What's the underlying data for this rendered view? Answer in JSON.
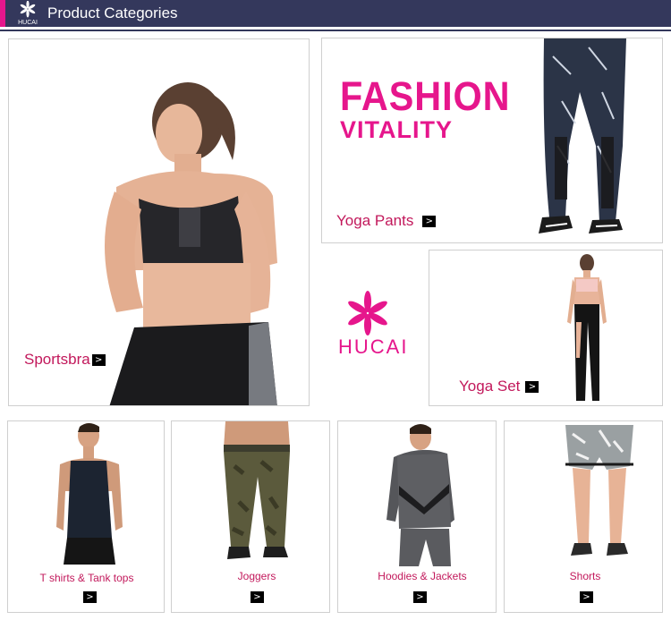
{
  "header": {
    "title": "Product Categories",
    "logo_text": "HUCAI"
  },
  "brand": {
    "logo_text": "HUCAI"
  },
  "banner": {
    "line1": "FASHION",
    "line2": "VITALITY"
  },
  "arrow_glyph": ">",
  "categories": [
    {
      "label": "Sportsbra"
    },
    {
      "label": "Yoga Pants"
    },
    {
      "label": "Yoga Set"
    },
    {
      "label": "T shirts & Tank tops"
    },
    {
      "label": "Joggers"
    },
    {
      "label": "Hoodies & Jackets"
    },
    {
      "label": "Shorts"
    }
  ],
  "colors": {
    "accent": "#e6168c",
    "header_bg": "#34385c",
    "label": "#c2185b"
  }
}
